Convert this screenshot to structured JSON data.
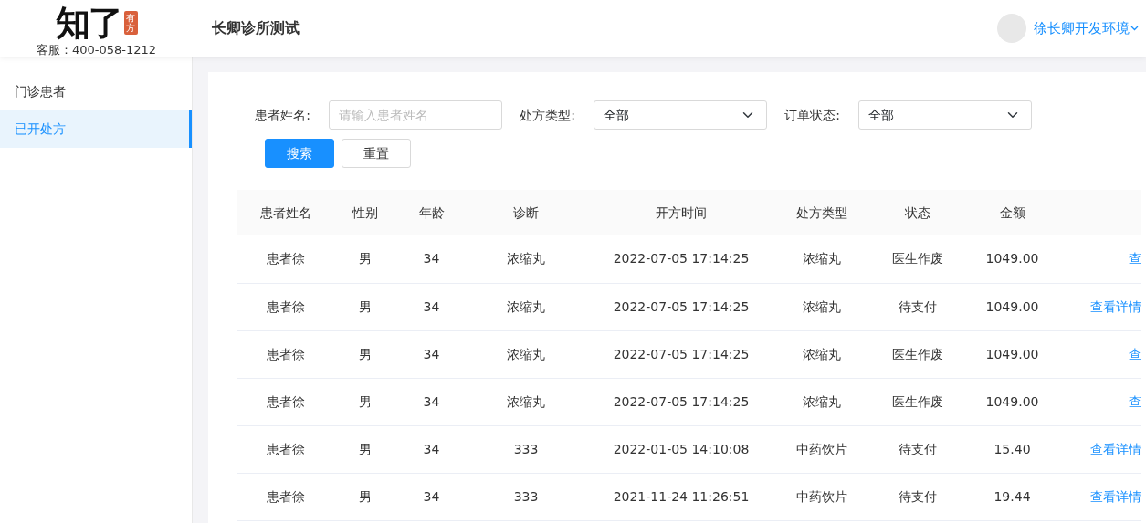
{
  "logo": {
    "name": "知了",
    "seal": "有方",
    "hotline": "客服：400-058-1212"
  },
  "header": {
    "title": "长卿诊所测试",
    "user": "徐长卿开发环境"
  },
  "sidebar": {
    "items": [
      {
        "label": "门诊患者",
        "selected": false
      },
      {
        "label": "已开处方",
        "selected": true
      }
    ]
  },
  "filters": [
    {
      "kind": "input",
      "label": "患者姓名:",
      "placeholder": "请输入患者姓名"
    },
    {
      "kind": "select",
      "label": "处方类型:",
      "value": "全部"
    },
    {
      "kind": "select",
      "label": "订单状态:",
      "value": "全部"
    }
  ],
  "buttons": [
    {
      "label": "搜索",
      "kind": "primary"
    },
    {
      "label": "重置",
      "kind": "default"
    }
  ],
  "table": {
    "columns": [
      "患者姓名",
      "性别",
      "年龄",
      "诊断",
      "开方时间",
      "处方类型",
      "状态",
      "金额"
    ],
    "rows": [
      {
        "cells": [
          "患者徐",
          "男",
          "34",
          "浓缩丸",
          "2022-07-05 17:14:25",
          "浓缩丸",
          "医生作废",
          "1049.00"
        ],
        "action": "查"
      },
      {
        "cells": [
          "患者徐",
          "男",
          "34",
          "浓缩丸",
          "2022-07-05 17:14:25",
          "浓缩丸",
          "待支付",
          "1049.00"
        ],
        "action": "查看详情"
      },
      {
        "cells": [
          "患者徐",
          "男",
          "34",
          "浓缩丸",
          "2022-07-05 17:14:25",
          "浓缩丸",
          "医生作废",
          "1049.00"
        ],
        "action": "查"
      },
      {
        "cells": [
          "患者徐",
          "男",
          "34",
          "浓缩丸",
          "2022-07-05 17:14:25",
          "浓缩丸",
          "医生作废",
          "1049.00"
        ],
        "action": "查"
      },
      {
        "cells": [
          "患者徐",
          "男",
          "34",
          "333",
          "2022-01-05 14:10:08",
          "中药饮片",
          "待支付",
          "15.40"
        ],
        "action": "查看详情"
      },
      {
        "cells": [
          "患者徐",
          "男",
          "34",
          "333",
          "2021-11-24 11:26:51",
          "中药饮片",
          "待支付",
          "19.44"
        ],
        "action": "查看详情"
      }
    ]
  }
}
